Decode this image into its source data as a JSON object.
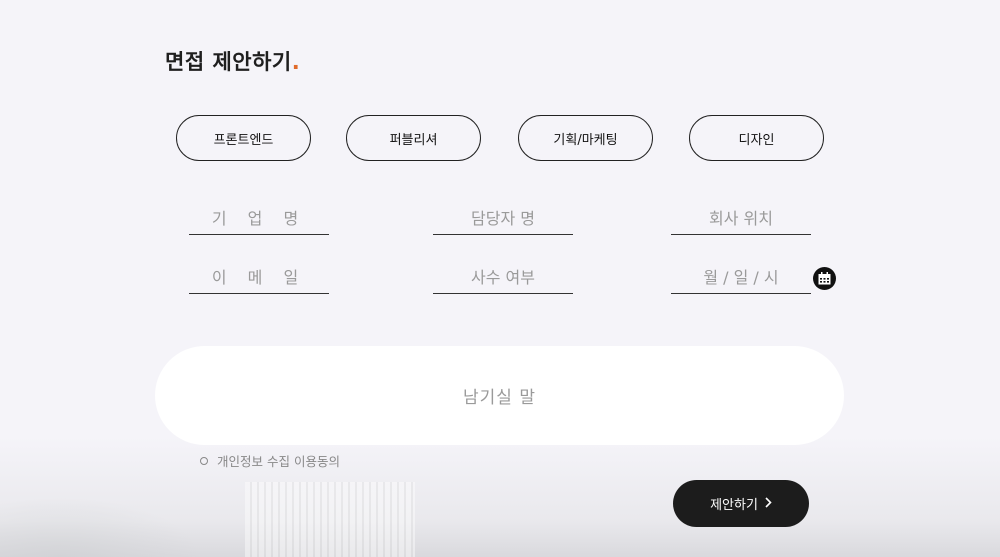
{
  "title": {
    "text": "면접 제안하기",
    "dot": ".",
    "dot_color": "#e06b2b"
  },
  "categories": [
    {
      "label": "프론트엔드"
    },
    {
      "label": "퍼블리셔"
    },
    {
      "label": "기획/마케팅"
    },
    {
      "label": "디자인"
    }
  ],
  "fields": {
    "company_name": {
      "placeholder": "기 업 명"
    },
    "manager_name": {
      "placeholder": "담당자 명"
    },
    "company_location": {
      "placeholder": "회사 위치"
    },
    "email": {
      "placeholder": "이 메 일"
    },
    "onsite": {
      "placeholder": "사수 여부"
    },
    "datetime": {
      "placeholder": "월 / 일 / 시",
      "icon": "calendar-icon"
    }
  },
  "message": {
    "placeholder": "남기실 말"
  },
  "consent": {
    "label": "개인정보 수집 이용동의"
  },
  "submit": {
    "label": "제안하기",
    "icon": "chevron-right-icon"
  }
}
